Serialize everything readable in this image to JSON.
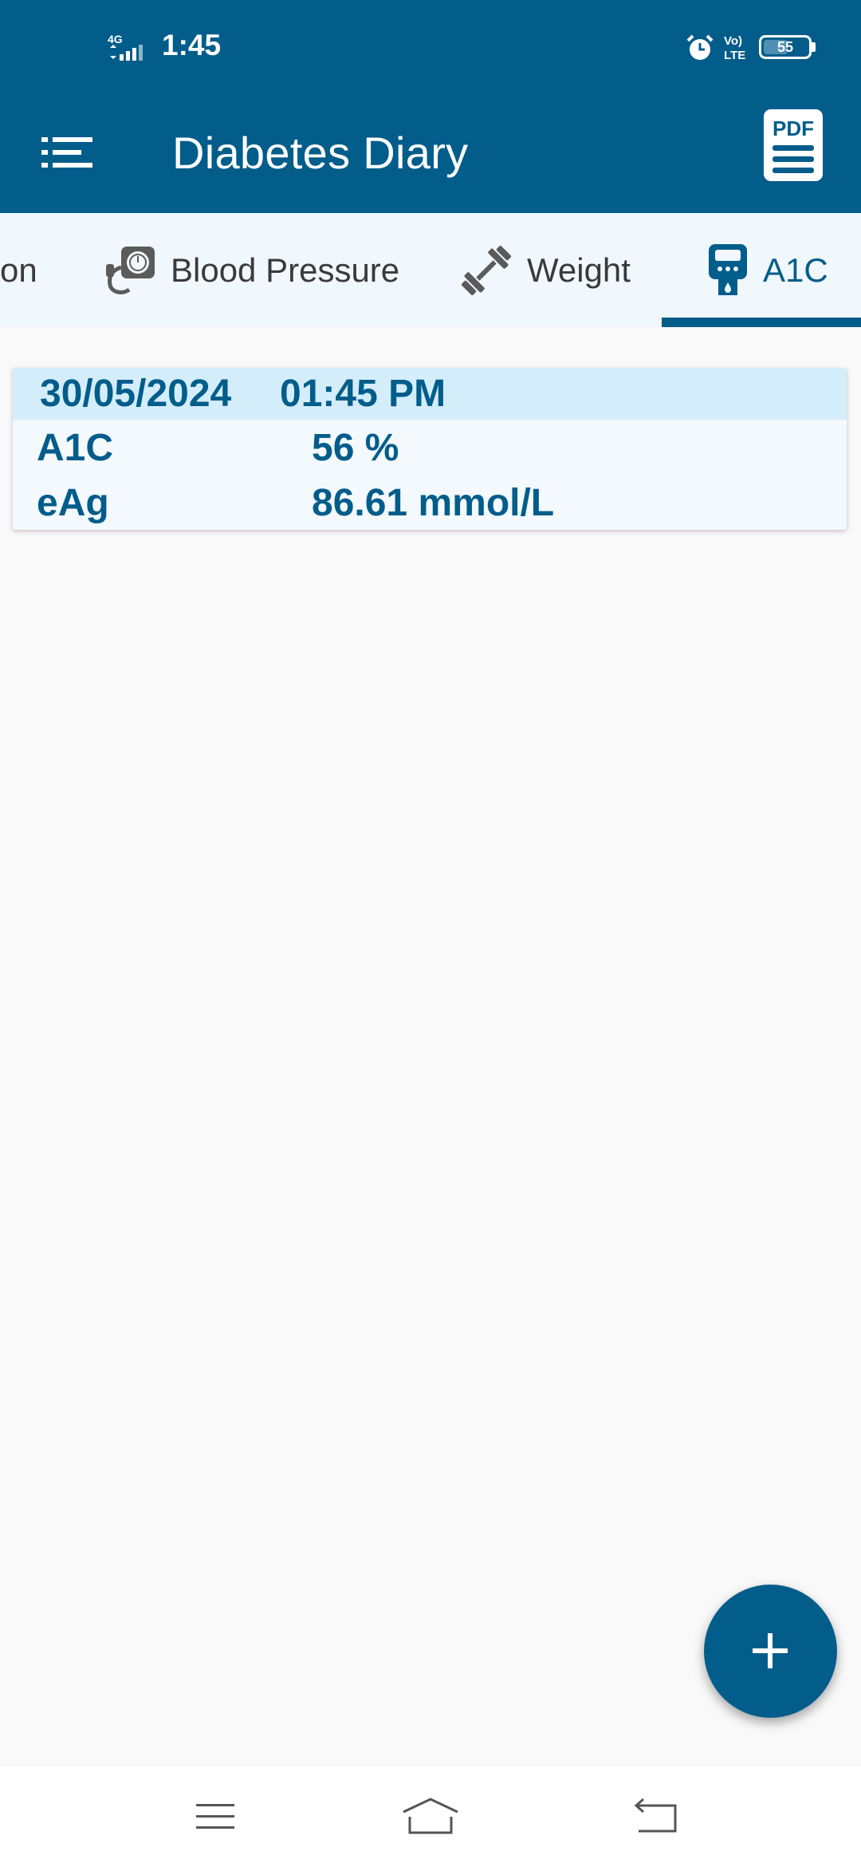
{
  "status_bar": {
    "network": "4G",
    "time": "1:45",
    "volte": "Vo) LTE",
    "battery": "55",
    "battery_level": 0.55,
    "icons": [
      "signal-icon",
      "alarm-icon",
      "volte-icon",
      "battery-icon"
    ]
  },
  "app_bar": {
    "title": "Diabetes Diary",
    "pdf_label": "PDF",
    "icons": [
      "menu-icon",
      "pdf-icon"
    ]
  },
  "tabs": [
    {
      "label": "on",
      "icon": "",
      "active": false
    },
    {
      "label": "Blood Pressure",
      "icon": "blood-pressure-icon",
      "active": false
    },
    {
      "label": "Weight",
      "icon": "dumbbell-icon",
      "active": false
    },
    {
      "label": "A1C",
      "icon": "glucometer-icon",
      "active": true
    }
  ],
  "records": [
    {
      "date": "30/05/2024",
      "time": "01:45 PM",
      "rows": [
        {
          "label": "A1C",
          "value": "56 %"
        },
        {
          "label": "eAg",
          "value": "86.61 mmol/L"
        }
      ]
    }
  ],
  "fab": {
    "icon": "plus-icon"
  },
  "nav_bar": {
    "icons": [
      "recents-icon",
      "home-icon",
      "back-icon"
    ]
  },
  "colors": {
    "primary": "#035d8b",
    "tab_background": "#f0f8fd",
    "card_header": "#d4edfa",
    "card_body": "#f3f9fd",
    "background": "#f9f9f9"
  }
}
